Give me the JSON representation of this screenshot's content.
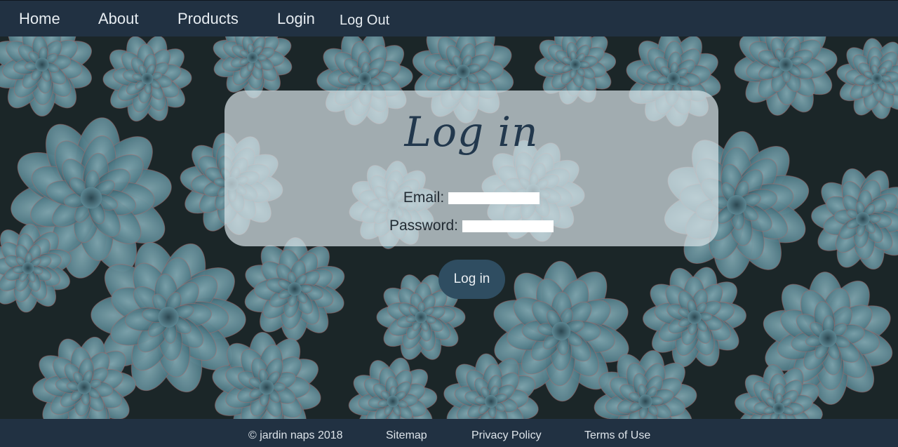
{
  "nav": {
    "items": [
      {
        "label": "Home"
      },
      {
        "label": "About"
      },
      {
        "label": "Products"
      },
      {
        "label": "Login"
      },
      {
        "label": "Log Out"
      }
    ]
  },
  "login": {
    "title": "Log in",
    "email_label": "Email:",
    "email_value": "",
    "password_label": "Password:",
    "password_value": "",
    "submit_label": "Log in"
  },
  "footer": {
    "copyright": "© jardin naps 2018",
    "links": [
      {
        "label": "Sitemap"
      },
      {
        "label": "Privacy Policy"
      },
      {
        "label": "Terms of Use"
      }
    ]
  },
  "colors": {
    "bar": "#213142",
    "button": "#2f4d61",
    "title": "#22384d"
  },
  "background": {
    "image": "succulent-rosettes"
  }
}
